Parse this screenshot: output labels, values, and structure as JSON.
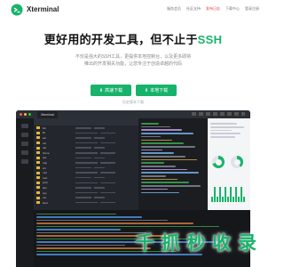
{
  "header": {
    "brand": "Xterminal",
    "nav": [
      {
        "label": "服务会员",
        "highlight": false
      },
      {
        "label": "社区支持",
        "highlight": false
      },
      {
        "label": "发布日志",
        "highlight": true
      },
      {
        "label": "下载中心",
        "highlight": false
      },
      {
        "label": "登录注册",
        "highlight": false
      }
    ]
  },
  "hero": {
    "title_main": "更好用的开发工具，但不止于",
    "title_accent": "SSH",
    "subtitle_lines": [
      "不仅是强大的SSH工具，更提供本地控制台，以及更多即将",
      "推出的开发相关功能，让您专注于创造卓越的代码",
      ""
    ],
    "download_primary": "高速下载",
    "download_secondary": "本地下载",
    "history_link": "历史版本下载"
  },
  "app_window": {
    "tabs": [
      "Xterminal",
      ""
    ],
    "files": [
      "bin",
      "lib",
      "etc",
      "usr",
      "var",
      "home",
      "opt",
      "tmp",
      "srv",
      "mnt",
      "root",
      "proc",
      "dev",
      "sys",
      "run",
      "boot"
    ]
  },
  "overlay": {
    "watermark": "千 抓 秒 收 录"
  },
  "colors": {
    "accent": "#18b36b",
    "nav_highlight": "#e53935",
    "app_bg": "#1f2227"
  }
}
